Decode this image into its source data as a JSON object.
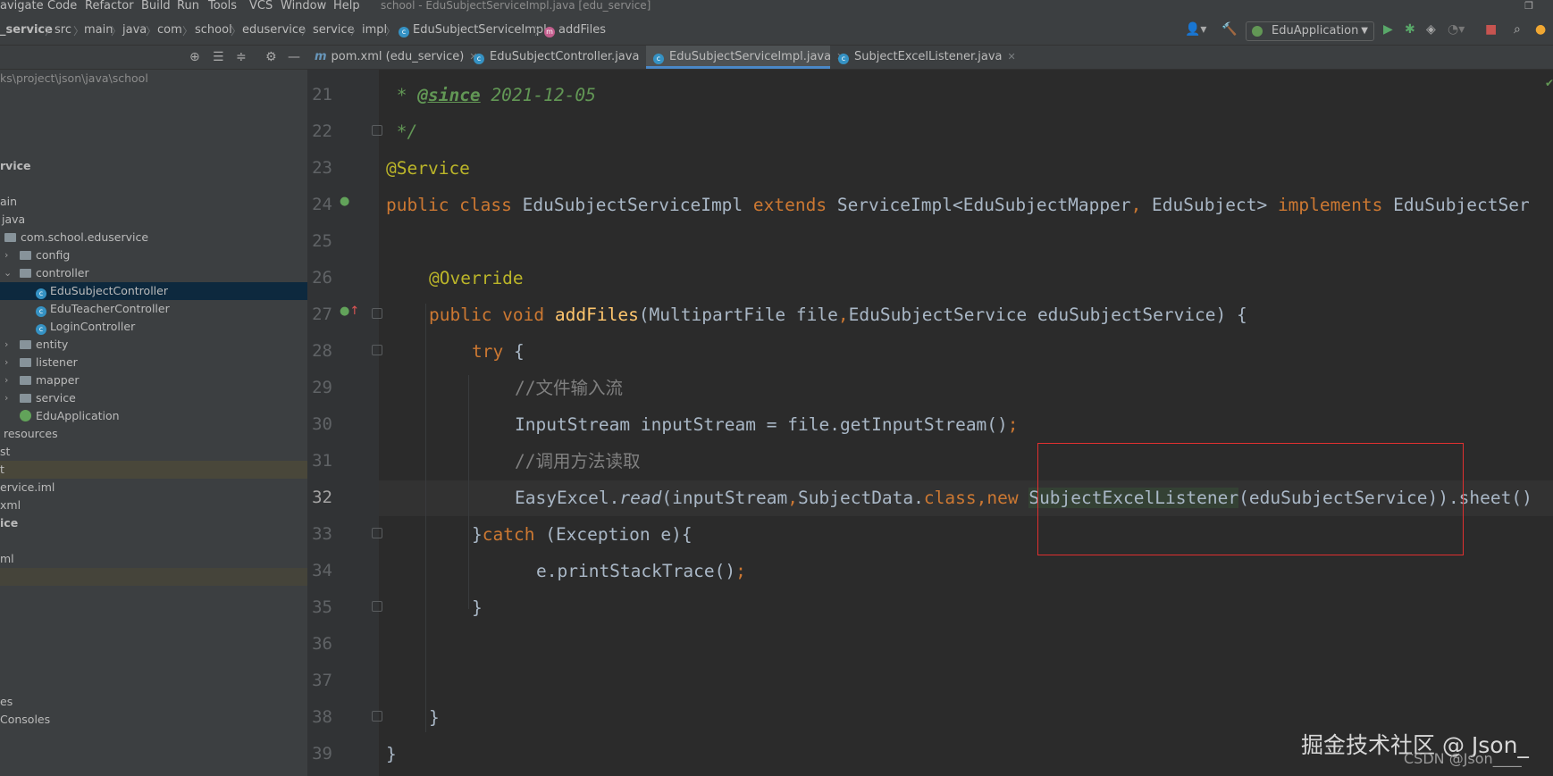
{
  "menu": {
    "items": [
      "avigate",
      "Code",
      "Refactor",
      "Build",
      "Run",
      "Tools",
      "VCS",
      "Window",
      "Help"
    ],
    "window_title": "school - EduSubjectServiceImpl.java [edu_service]"
  },
  "breadcrumbs": [
    "_service",
    "src",
    "main",
    "java",
    "com",
    "school",
    "eduservice",
    "service",
    "impl",
    "EduSubjectServiceImpl",
    "addFiles"
  ],
  "run_config": {
    "label": "EduApplication"
  },
  "tabs": [
    {
      "label": "pom.xml (edu_service)",
      "kind": "maven",
      "active": false
    },
    {
      "label": "EduSubjectController.java",
      "kind": "class",
      "active": false
    },
    {
      "label": "EduSubjectServiceImpl.java",
      "kind": "class",
      "active": true
    },
    {
      "label": "SubjectExcelListener.java",
      "kind": "class",
      "active": false
    }
  ],
  "project_tree": {
    "path_hint": "ks\\project\\json\\java\\school",
    "items": [
      {
        "label": "rvice",
        "level": 0
      },
      {
        "label": "ain",
        "level": 0
      },
      {
        "label": "java",
        "level": 0
      },
      {
        "label": "com.school.eduservice",
        "level": 1
      },
      {
        "label": "config",
        "level": 2
      },
      {
        "label": "controller",
        "level": 2
      },
      {
        "label": "EduSubjectController",
        "level": 3
      },
      {
        "label": "EduTeacherController",
        "level": 3
      },
      {
        "label": "LoginController",
        "level": 3
      },
      {
        "label": "entity",
        "level": 2
      },
      {
        "label": "listener",
        "level": 2
      },
      {
        "label": "mapper",
        "level": 2
      },
      {
        "label": "service",
        "level": 2
      },
      {
        "label": "EduApplication",
        "level": 2
      },
      {
        "label": "resources",
        "level": 0
      },
      {
        "label": "st",
        "level": 0
      },
      {
        "label": "t",
        "level": 0
      },
      {
        "label": "ervice.iml",
        "level": 0
      },
      {
        "label": "xml",
        "level": 0
      },
      {
        "label": "ice",
        "level": 0
      },
      {
        "label": "ml",
        "level": 0
      },
      {
        "label": "es",
        "level": 0
      },
      {
        "label": "Consoles",
        "level": 0
      }
    ]
  },
  "editor": {
    "line_numbers": [
      "21",
      "22",
      "23",
      "24",
      "25",
      "26",
      "27",
      "28",
      "29",
      "30",
      "31",
      "32",
      "33",
      "34",
      "35",
      "36",
      "37",
      "38",
      "39"
    ],
    "current_line": "32",
    "code": {
      "l21_star": " * ",
      "l21_tag": "@since",
      "l21_text": " 2021-12-05",
      "l22": " */",
      "l23": "@Service",
      "l24_kw1": "public class ",
      "l24_name": "EduSubjectServiceImpl ",
      "l24_kw2": "extends ",
      "l24_base": "ServiceImpl<EduSubjectMapper",
      "l24_comma": ",",
      "l24_rest": " EduSubject> ",
      "l24_kw3": "implements ",
      "l24_iface": "EduSubjectSer",
      "l26": "@Override",
      "l27_kw": "public void ",
      "l27_fn": "addFiles",
      "l27_a": "(MultipartFile file",
      "l27_comma": ",",
      "l27_b": "EduSubjectService eduSubjectService) {",
      "l28_kw": "try ",
      "l28_b": "{",
      "l29_slashes": "//",
      "l29_text": "文件输入流",
      "l30_a": "InputStream inputStream = file.getInputStream()",
      "l30_semi": ";",
      "l31_slashes": "//",
      "l31_text": "调用方法读取",
      "l32_a": "EasyExcel.",
      "l32_read": "read",
      "l32_b": "(inputStream",
      "l32_c1": ",",
      "l32_c": "SubjectData.",
      "l32_cls": "class",
      "l32_c2": ",",
      "l32_new": "new ",
      "l32_listener": "SubjectExcelListener",
      "l32_d": "(eduSubjectService)).sheet()",
      "l33_a": "}",
      "l33_kw": "catch ",
      "l33_b": "(Exception e){",
      "l34_a": "e.printStackTrace()",
      "l34_semi": ";",
      "l35": "}",
      "l38": "}",
      "l39": "}"
    }
  },
  "watermark": {
    "main": "掘金技术社区 @ Json_",
    "sub": "CSDN @Json____"
  },
  "colors": {
    "keyword": "#cc7832",
    "annotation": "#bbb529",
    "comment": "#629755",
    "function": "#ffc66d",
    "highlight_box": "#e03030"
  }
}
